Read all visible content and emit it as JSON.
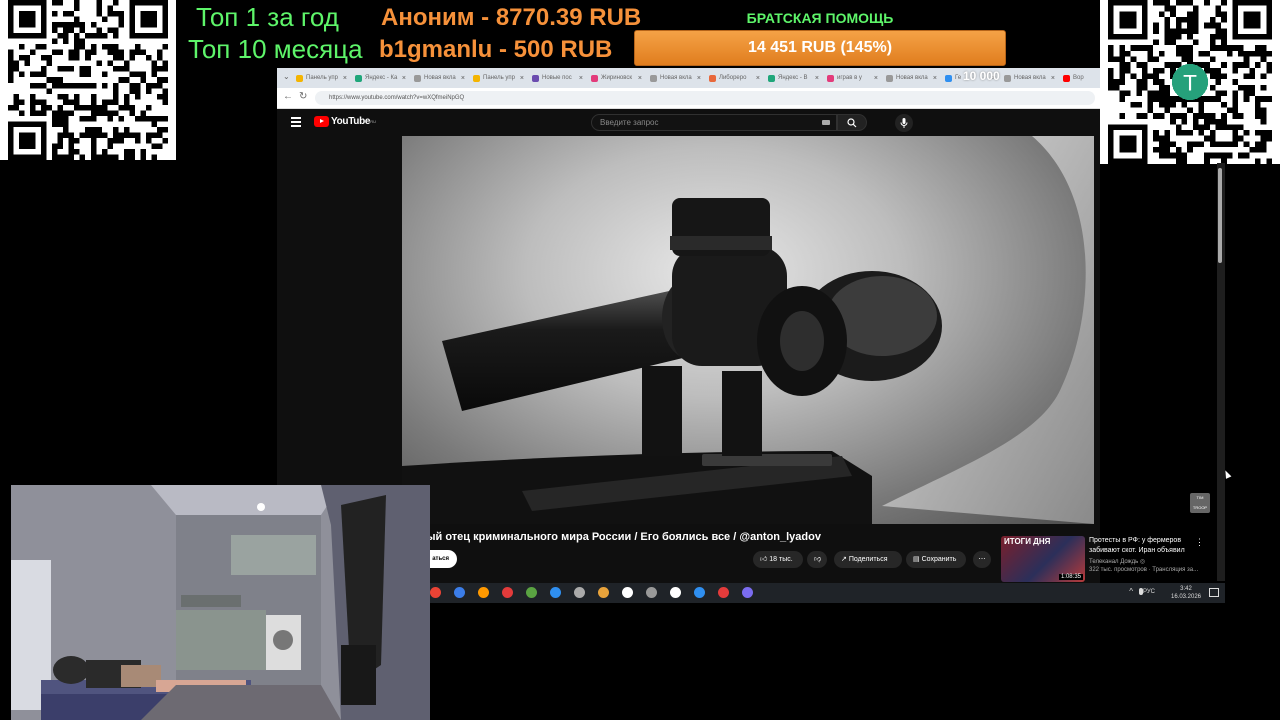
{
  "overlay": {
    "top_year_label": "Топ 1 за год",
    "top_month_label": "Топ 10 месяца",
    "donation_1": "Аноним - 8770.39 RUB",
    "donation_2": "b1gmanlu - 500 RUB",
    "goal_title": "БРАТСКАЯ ПОМОЩЬ",
    "goal_amount": "14 451 RUB (145%)",
    "goal_progress_percent": 100,
    "tab_counter": "10 000",
    "colors": {
      "green": "#5ef56a",
      "orange": "#f6913a",
      "goal_bar": "#e78a2c"
    }
  },
  "browser": {
    "tabs": [
      {
        "label": "Панель упр",
        "color": "#f4b400"
      },
      {
        "label": "Яндекс - Ка",
        "color": "#1fa67a"
      },
      {
        "label": "Новая вкла",
        "color": "#999999"
      },
      {
        "label": "Панель упр",
        "color": "#f4b400"
      },
      {
        "label": "Новые пос",
        "color": "#6b4caf"
      },
      {
        "label": "Жириновск",
        "color": "#e33b7b"
      },
      {
        "label": "Новая вкла",
        "color": "#999999"
      },
      {
        "label": "Либореро",
        "color": "#e8683b"
      },
      {
        "label": "Яндекс - В",
        "color": "#1fa67a"
      },
      {
        "label": "играв в у",
        "color": "#e33b7b"
      },
      {
        "label": "Новая вкла",
        "color": "#999999"
      },
      {
        "label": "Ге",
        "color": "#2f8ff0"
      },
      {
        "label": "Новая вкла",
        "color": "#999999"
      },
      {
        "label": "Вор",
        "color": "#ff0000"
      }
    ],
    "url": "https://www.youtube.com/watch?v=wXQfmeiNpGQ"
  },
  "youtube": {
    "logo_text": "YouTube",
    "region": "RU",
    "search_placeholder": "Введите запрос",
    "video_title": "естный отец криминального мира России / Его боялись все / @anton_lyadov",
    "subscribe_label": "аться",
    "like_count": "18 тыс.",
    "share_label": "Поделиться",
    "save_label": "Сохранить",
    "more_glyph": "⋯",
    "related": {
      "title": "Протесты в РФ: у фермеров забивают скот. Иран объявил",
      "thumb_tag": "ИТОГИ ДНЯ",
      "duration": "1:08:35",
      "channel": "Телеканал Дождь ◎",
      "views": "322 тыс. просмотров · Трансляция за..."
    },
    "corner_badge": "TIM TROOP"
  },
  "taskbar": {
    "icon_colors": [
      "#ea4335",
      "#3b7de9",
      "#ff9900",
      "#e33b3b",
      "#5aa342",
      "#2f8ff0",
      "#aaaaaa",
      "#e8a33b",
      "#ffffff",
      "#999999",
      "#ffffff",
      "#2f8ff0",
      "#e33b3b",
      "#7b6cf0"
    ],
    "language": "РУС",
    "time": "3:42",
    "date": "16.03.2026"
  }
}
